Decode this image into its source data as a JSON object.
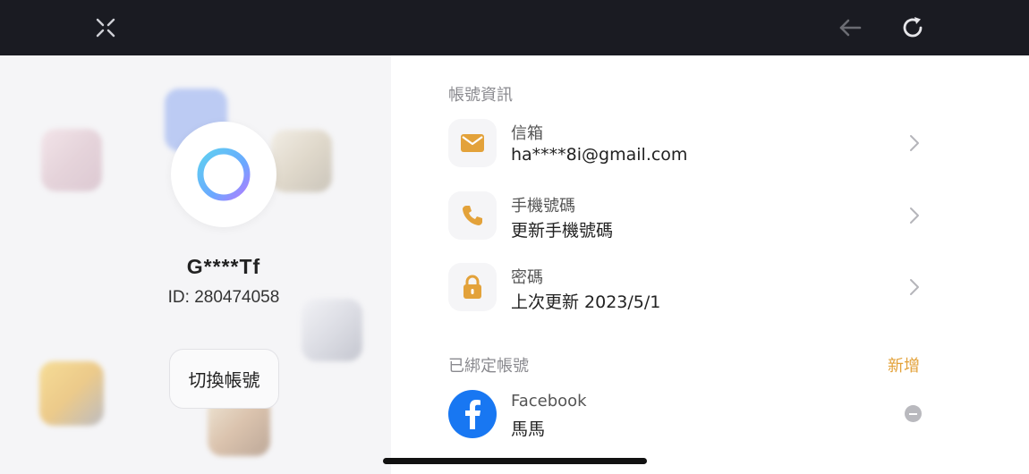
{
  "topbar": {
    "close_icon": "close-x-icon",
    "back_icon": "back-arrow-icon",
    "refresh_icon": "refresh-icon"
  },
  "profile": {
    "username": "G****Tf",
    "id_text": "ID: 280474058",
    "switch_label": "切換帳號"
  },
  "account_info": {
    "section_title": "帳號資訊",
    "rows": [
      {
        "label": "信箱",
        "value": "ha****8i@gmail.com",
        "icon": "mail-icon"
      },
      {
        "label": "手機號碼",
        "value": "更新手機號碼",
        "icon": "phone-icon"
      },
      {
        "label": "密碼",
        "value": "上次更新 2023/5/1",
        "icon": "lock-icon"
      }
    ]
  },
  "bound_accounts": {
    "section_title": "已綁定帳號",
    "add_label": "新增",
    "items": [
      {
        "provider": "Facebook",
        "name": "馬馬",
        "icon": "facebook-icon"
      }
    ]
  },
  "colors": {
    "accent": "#e3a23a",
    "topbar": "#1a1b22",
    "facebook": "#1877f2"
  }
}
